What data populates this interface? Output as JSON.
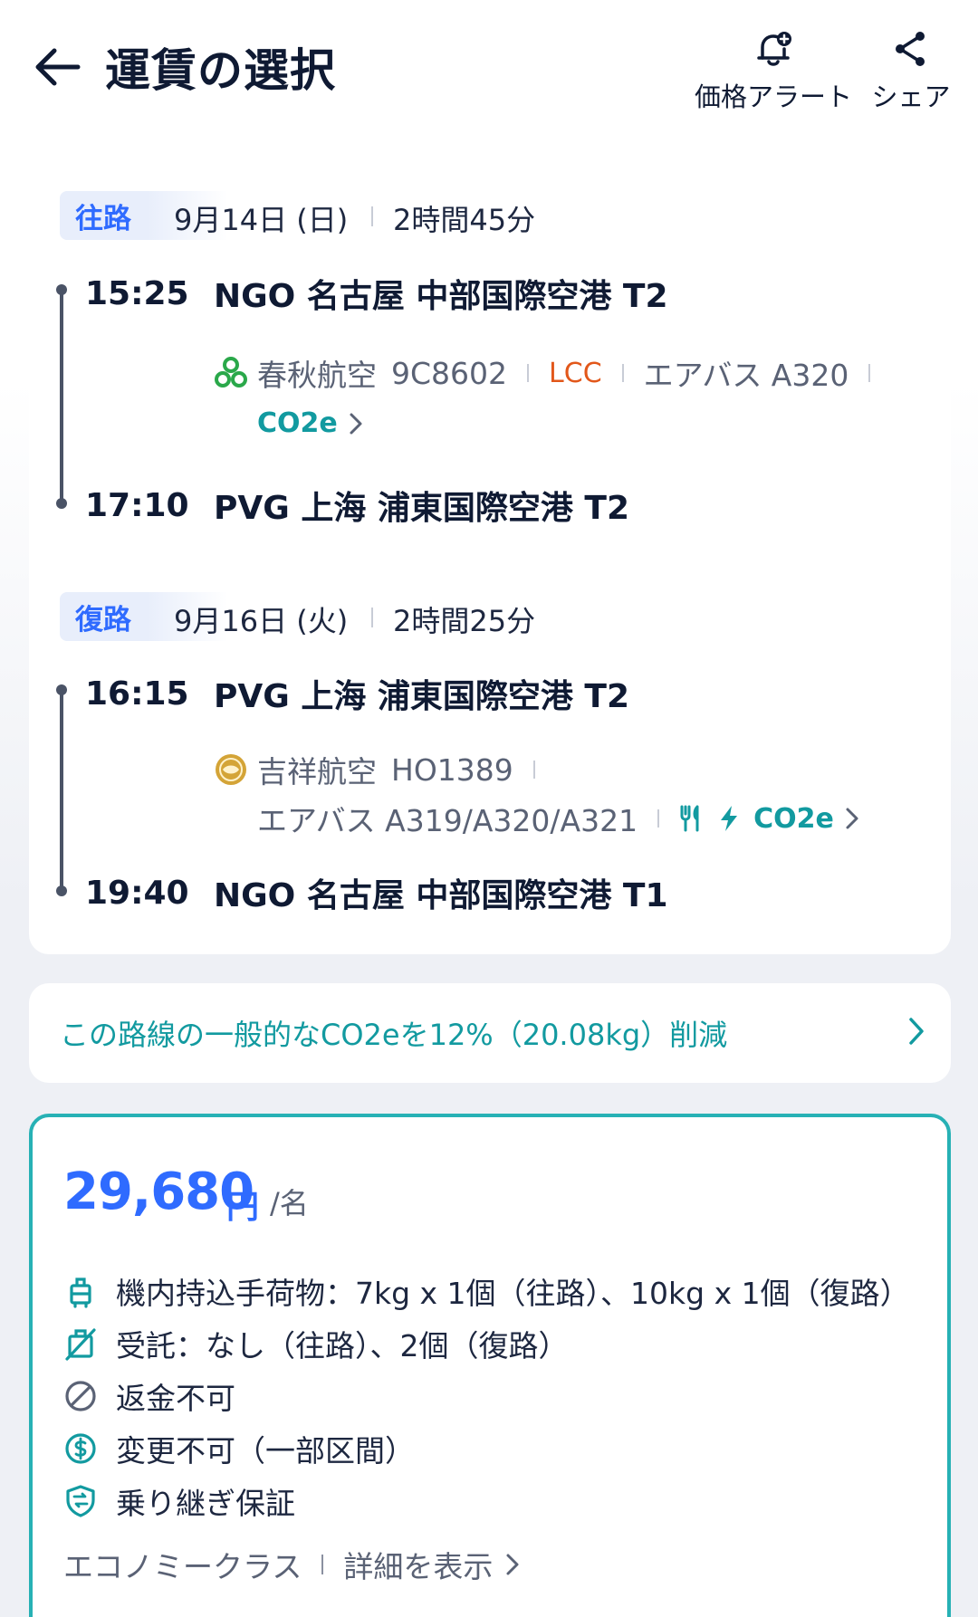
{
  "header": {
    "title": "運賃の選択",
    "price_alert_label": "価格アラート",
    "share_label": "シェア"
  },
  "outbound": {
    "tag": "往路",
    "date": "9月14日 (日)",
    "duration": "2時間45分",
    "depart_time": "15:25",
    "depart_airport": "NGO 名古屋 中部国際空港 T2",
    "airline": "春秋航空",
    "flight_no": "9C8602",
    "lcc_badge": "LCC",
    "aircraft": "エアバス A320",
    "co2_link": "CO2e",
    "arrive_time": "17:10",
    "arrive_airport": "PVG 上海 浦東国際空港 T2"
  },
  "inbound": {
    "tag": "復路",
    "date": "9月16日 (火)",
    "duration": "2時間25分",
    "depart_time": "16:15",
    "depart_airport": "PVG 上海 浦東国際空港 T2",
    "airline": "吉祥航空",
    "flight_no": "HO1389",
    "aircraft": "エアバス A319/A320/A321",
    "co2_link": "CO2e",
    "arrive_time": "19:40",
    "arrive_airport": "NGO 名古屋 中部国際空港 T1"
  },
  "co2_banner": {
    "text": "この路線の一般的なCO2eを12%（20.08kg）削減"
  },
  "fare": {
    "price": "29,680",
    "currency": "円",
    "per_person": "/名",
    "perks": [
      {
        "icon": "carry-on-bag-icon",
        "text": "機内持込手荷物：7kg x 1個（往路）、10kg x 1個（復路）"
      },
      {
        "icon": "checked-bag-icon",
        "text": "受託：なし（往路）、2個（復路）"
      },
      {
        "icon": "no-refund-icon",
        "text": "返金不可"
      },
      {
        "icon": "dollar-icon",
        "text": "変更不可（一部区間）"
      },
      {
        "icon": "shield-icon",
        "text": "乗り継ぎ保証"
      }
    ],
    "cabin_class": "エコノミークラス",
    "details_link": "詳細を表示"
  },
  "colors": {
    "accent_blue": "#2f6bff",
    "teal": "#129aa0",
    "lcc_orange": "#e2571a",
    "card_border": "#27b1b5"
  }
}
